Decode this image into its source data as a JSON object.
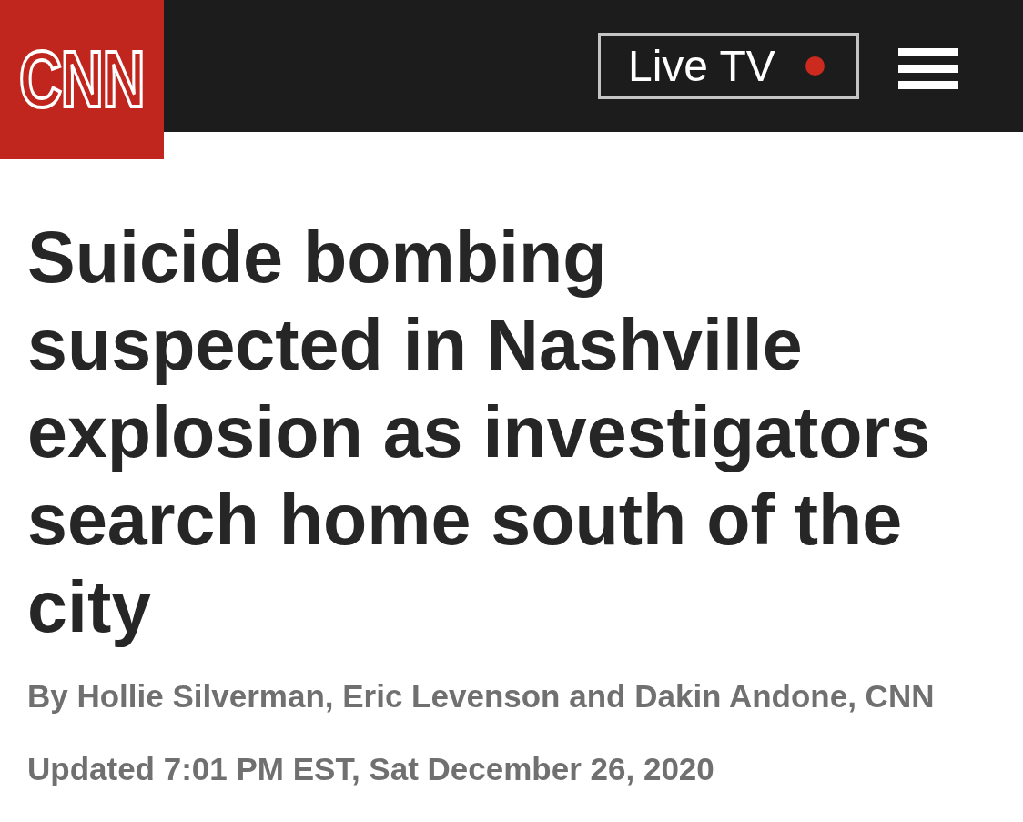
{
  "header": {
    "logo": {
      "text": "CNN"
    },
    "live_button": {
      "label": "Live TV"
    }
  },
  "article": {
    "headline": "Suicide bombing suspected in Nashville explosion as investigators search home south of the city",
    "byline": "By Hollie Silverman, Eric Levenson and Dakin Andone, CNN",
    "updated": "Updated 7:01 PM EST, Sat December 26, 2020"
  }
}
